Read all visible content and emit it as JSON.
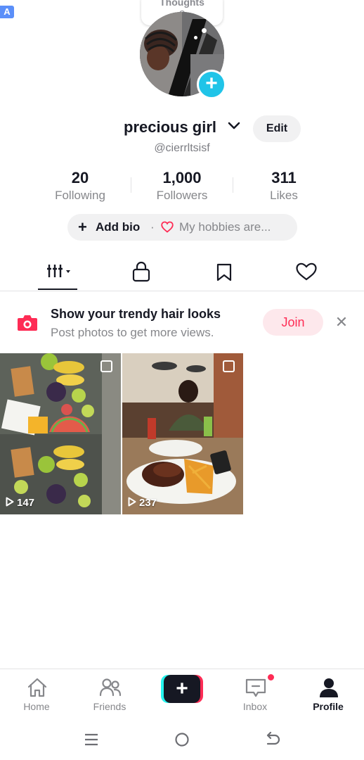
{
  "status_badge": "A",
  "thought_bubble": {
    "line1": "Thoughts",
    "line2": "?"
  },
  "profile": {
    "display_name": "precious girl",
    "username": "@cierrltsisf",
    "edit_label": "Edit"
  },
  "stats": [
    {
      "value": "20",
      "label": "Following"
    },
    {
      "value": "1,000",
      "label": "Followers"
    },
    {
      "value": "311",
      "label": "Likes"
    }
  ],
  "bio": {
    "add_bio_label": "Add bio",
    "separator": "·",
    "hobbies_label": "My hobbies are..."
  },
  "content_tabs": [
    {
      "icon": "grid-icon",
      "active": true
    },
    {
      "icon": "lock-icon",
      "active": false
    },
    {
      "icon": "bookmark-icon",
      "active": false
    },
    {
      "icon": "heart-icon",
      "active": false
    }
  ],
  "promo": {
    "title": "Show your trendy hair looks",
    "subtitle": "Post photos to get more views.",
    "join_label": "Join",
    "close_icon": "close-icon"
  },
  "videos": [
    {
      "views": "147",
      "subject": "fruit platter"
    },
    {
      "views": "237",
      "subject": "girl at restaurant with ribs and fries"
    }
  ],
  "bottom_nav": [
    {
      "label": "Home",
      "icon": "home-icon"
    },
    {
      "label": "Friends",
      "icon": "friends-icon"
    },
    {
      "label": "",
      "icon": "plus-icon"
    },
    {
      "label": "Inbox",
      "icon": "inbox-icon",
      "has_notification": true
    },
    {
      "label": "Profile",
      "icon": "profile-icon",
      "active": true
    }
  ],
  "colors": {
    "accent": "#fe2c55",
    "cyan": "#25f4ee",
    "avatar_add": "#20c4e8",
    "text_primary": "#161823",
    "text_secondary": "#86878b"
  }
}
